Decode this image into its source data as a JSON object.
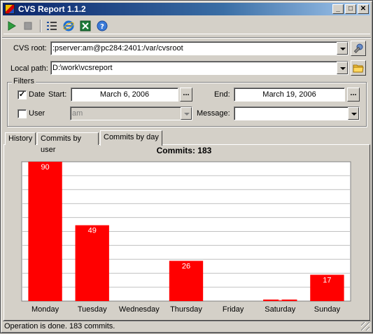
{
  "window": {
    "title": "CVS Report 1.1.2"
  },
  "toolbar": {
    "tools": [
      "play-icon",
      "stop-icon",
      "list-icon",
      "internet-explorer-icon",
      "excel-icon",
      "help-icon"
    ]
  },
  "cvs_root": {
    "label": "CVS root:",
    "value": ":pserver:am@pc284:2401:/var/cvsroot"
  },
  "local_path": {
    "label": "Local path:",
    "value": "D:\\work\\vcsreport"
  },
  "filters": {
    "label": "Filters",
    "date_checkbox": {
      "label": "Date",
      "checked": true,
      "mark": "✓"
    },
    "start_label": "Start:",
    "start_value": "March 6, 2006",
    "end_label": "End:",
    "end_value": "March 19, 2006",
    "browse_label": "...",
    "user_checkbox": {
      "label": "User",
      "checked": false
    },
    "user_value": "am",
    "message_label": "Message:",
    "message_value": ""
  },
  "tabs": [
    {
      "label": "History",
      "active": false
    },
    {
      "label": "Commits by user",
      "active": false
    },
    {
      "label": "Commits by day",
      "active": true
    }
  ],
  "chart_data": {
    "type": "bar",
    "title": "Commits: 183",
    "categories": [
      "Monday",
      "Tuesday",
      "Wednesday",
      "Thursday",
      "Friday",
      "Saturday",
      "Sunday"
    ],
    "values": [
      90,
      49,
      0,
      26,
      0,
      1,
      17
    ],
    "data_labels": [
      "90",
      "49",
      "",
      "26",
      "",
      "1",
      "17"
    ],
    "ylim": [
      0,
      90
    ],
    "grid": true,
    "bar_color": "#ff0000",
    "label_color": "#ffffff",
    "grid_color": "#c0c0c0"
  },
  "status": {
    "text": "Operation is done. 183 commits."
  },
  "colors": {
    "titlebar_start": "#0a246a",
    "titlebar_end": "#a6caf0",
    "face": "#d4d0c8"
  }
}
